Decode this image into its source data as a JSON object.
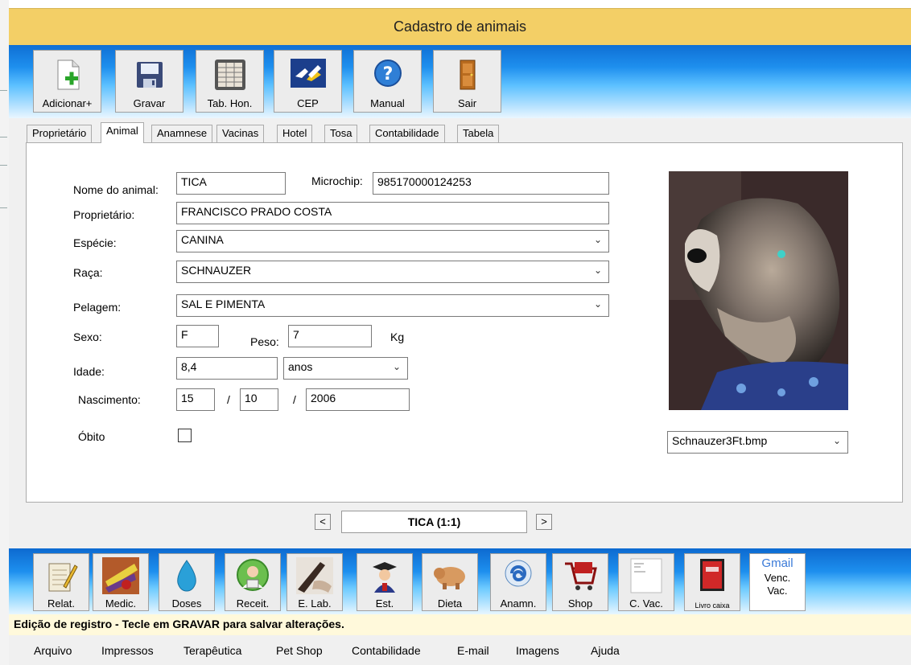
{
  "window": {
    "title": "Cadastro de animais"
  },
  "toolbar": {
    "add": "Adicionar+",
    "save": "Gravar",
    "fees": "Tab. Hon.",
    "cep": "CEP",
    "manual": "Manual",
    "exit": "Sair"
  },
  "tabs": [
    "Proprietário",
    "Animal",
    "Anamnese",
    "Vacinas",
    "Hotel",
    "Tosa",
    "Contabilidade",
    "Tabela"
  ],
  "active_tab": "Animal",
  "form": {
    "name_label": "Nome do animal:",
    "name_value": "TICA",
    "microchip_label": "Microchip:",
    "microchip_value": "985170000124253",
    "owner_label": "Proprietário:",
    "owner_value": "FRANCISCO PRADO COSTA",
    "species_label": "Espécie:",
    "species_value": "CANINA",
    "breed_label": "Raça:",
    "breed_value": "SCHNAUZER",
    "coat_label": "Pelagem:",
    "coat_value": "SAL E PIMENTA",
    "sex_label": "Sexo:",
    "sex_value": "F",
    "weight_label": "Peso:",
    "weight_value": "7",
    "weight_unit": "Kg",
    "age_label": "Idade:",
    "age_value": "8,4",
    "age_unit": "anos",
    "birth_label": "Nascimento:",
    "birth_day": "15",
    "birth_month": "10",
    "birth_year": "2006",
    "date_sep": "/",
    "death_label": "Óbito",
    "death_checked": false
  },
  "photo": {
    "file": "Schnauzer3Ft.bmp"
  },
  "nav": {
    "prev": "<",
    "record": "TICA (1:1)",
    "next": ">"
  },
  "bottom_toolbar": {
    "report": "Relat.",
    "meds": "Medic.",
    "doses": "Doses",
    "prescription": "Receit.",
    "lab": "E. Lab.",
    "students": "Est.",
    "diet": "Dieta",
    "anamnesis": "Anamn.",
    "shop": "Shop",
    "vaccine_card": "C. Vac.",
    "cashbook": "Livro caixa",
    "gmail_logo": "Gmail",
    "vaccine_due_1": "Venc.",
    "vaccine_due_2": "Vac."
  },
  "status": "Edição de registro - Tecle em GRAVAR para salvar alterações.",
  "menu": [
    "Arquivo",
    "Impressos",
    "Terapêutica",
    "Pet Shop",
    "Contabilidade",
    "E-mail",
    "Imagens",
    "Ajuda"
  ],
  "colors": {
    "title_bar": "#f3cf66",
    "toolbar_blue": "#1e8fee",
    "status_bg": "#fff9db"
  }
}
